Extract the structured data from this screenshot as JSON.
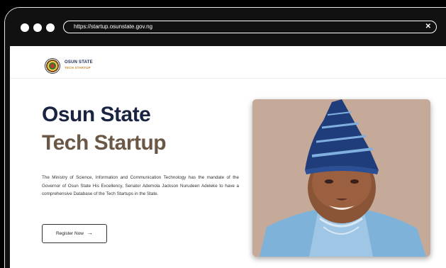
{
  "browser": {
    "url": "https://startup.osunstate.gov.ng",
    "close_glyph": "✕"
  },
  "header": {
    "logo_line1": "OSUN STATE",
    "logo_line2": "TECH STARTUP"
  },
  "hero": {
    "title_line1": "Osun State",
    "title_line2": "Tech Startup",
    "description": "The Ministry of Science, Information and Communication Technology has the mandate of the Governor of Osun State His Excellency, Senator Ademola Jackson Nurudeen Adeleke to have a comprehensive Database of the Tech Startups in the State.",
    "button_label": "Register Now",
    "button_arrow": "→"
  },
  "colors": {
    "title_dark": "#1a2340",
    "title_brown": "#6b5746",
    "logo_navy": "#1c2b5a",
    "logo_gold": "#c68b2c"
  }
}
